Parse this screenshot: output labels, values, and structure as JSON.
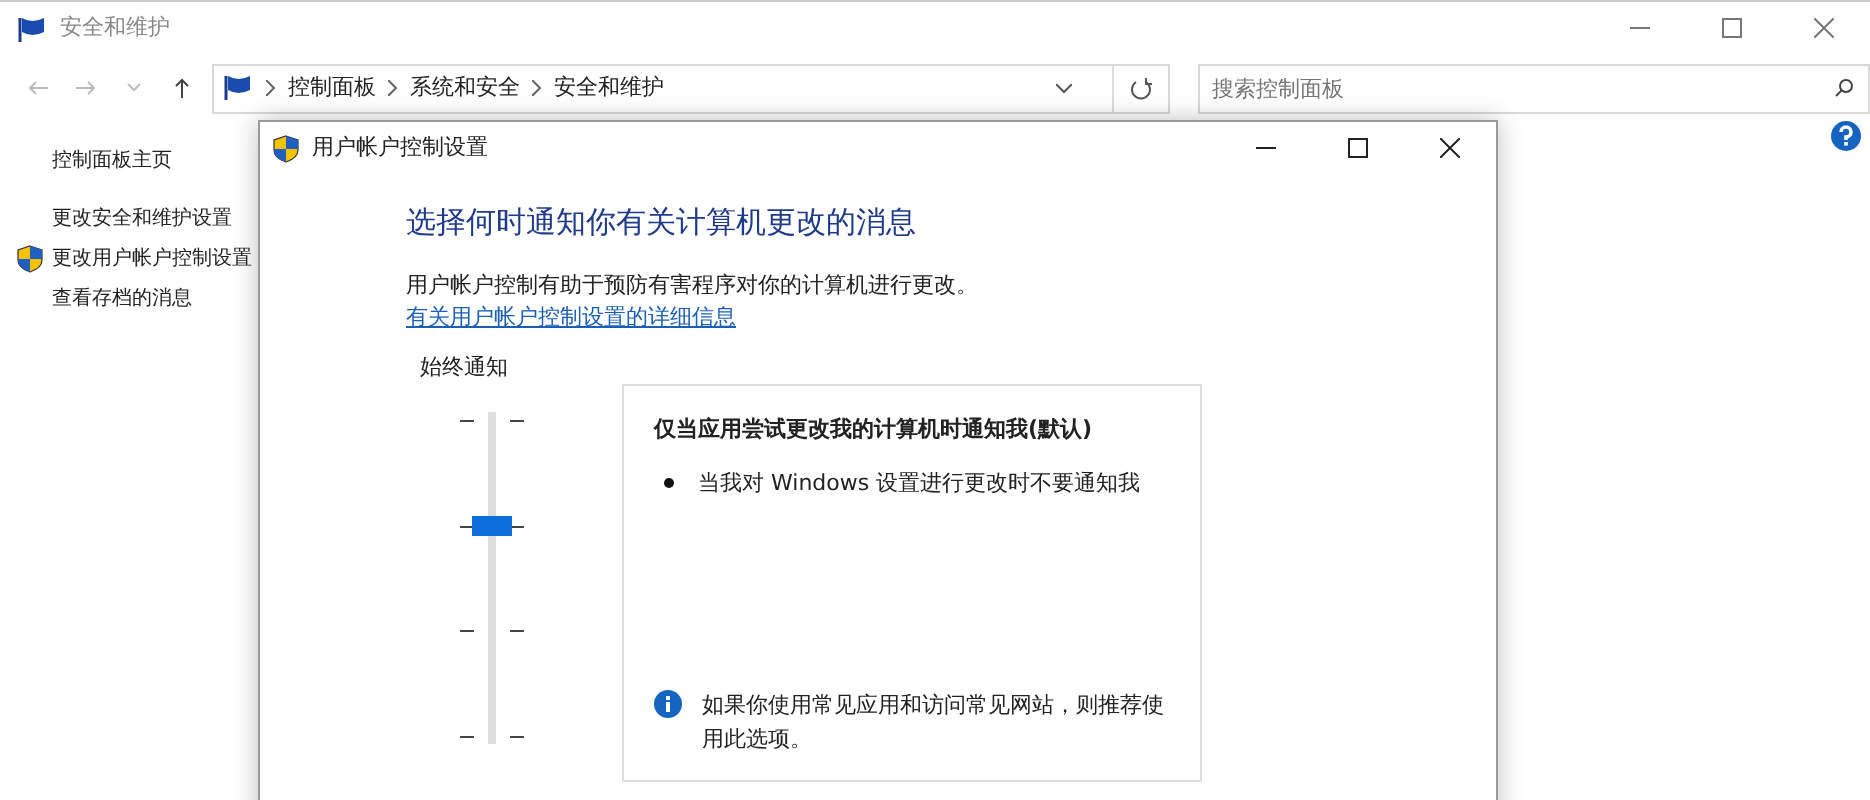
{
  "window": {
    "title": "安全和维护"
  },
  "breadcrumb": [
    "控制面板",
    "系统和安全",
    "安全和维护"
  ],
  "search": {
    "placeholder": "搜索控制面板"
  },
  "sidebar": {
    "items": [
      {
        "label": "控制面板主页",
        "shield": false
      },
      {
        "label": "更改安全和维护设置",
        "shield": false
      },
      {
        "label": "更改用户帐户控制设置",
        "shield": true
      },
      {
        "label": "查看存档的消息",
        "shield": false
      }
    ]
  },
  "dialog": {
    "title": "用户帐户控制设置",
    "heading": "选择何时通知你有关计算机更改的消息",
    "description": "用户帐户控制有助于预防有害程序对你的计算机进行更改。",
    "link": "有关用户帐户控制设置的详细信息",
    "slider": {
      "top_label": "始终通知",
      "level": 0.667
    },
    "panel": {
      "title": "仅当应用尝试更改我的计算机时通知我(默认)",
      "bullets": [
        "当我对 Windows 设置进行更改时不要通知我"
      ],
      "note": "如果你使用常见应用和访问常见网站，则推荐使用此选项。"
    }
  }
}
